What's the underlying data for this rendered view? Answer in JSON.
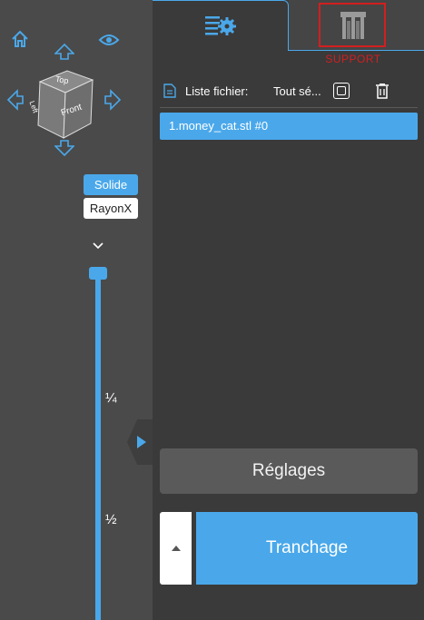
{
  "view": {
    "mode_solid_label": "Solide",
    "mode_xray_label": "RayonX",
    "cube_top_label": "Top",
    "cube_front_label": "Front",
    "cube_side_label": "Left",
    "layer_marks": [
      "¼",
      "½"
    ]
  },
  "tabs": {
    "support_label": "SUPPORT"
  },
  "file_list": {
    "title": "Liste fichier:",
    "select_all_label": "Tout sé...",
    "items": [
      "1.money_cat.stl #0"
    ]
  },
  "actions": {
    "settings_label": "Réglages",
    "slice_label": "Tranchage"
  },
  "colors": {
    "accent": "#4aa8ea",
    "support_highlight": "#d21f1f",
    "panel_bg": "#3a3a3a",
    "viewport_bg": "#4a4a4a"
  }
}
